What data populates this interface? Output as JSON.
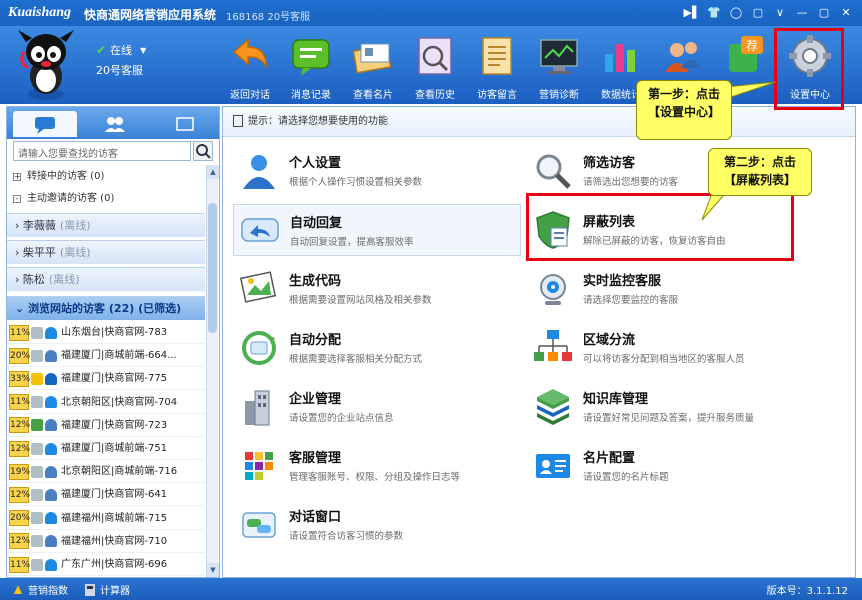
{
  "titlebar": {
    "logo": "Kuaishang",
    "title": "快商通网络营销应用系统",
    "account": "168168 20号客服",
    "buttons": [
      "▶▌",
      "👕",
      "◯",
      "▢",
      "∨",
      "—",
      "▢",
      "✕"
    ]
  },
  "agent": {
    "status": "在线",
    "name": "20号客服"
  },
  "toolbar": {
    "items": [
      {
        "label": "返回对话",
        "icon": "back-arrow-icon"
      },
      {
        "label": "消息记录",
        "icon": "message-log-icon"
      },
      {
        "label": "查看名片",
        "icon": "business-card-icon"
      },
      {
        "label": "查看历史",
        "icon": "history-icon"
      },
      {
        "label": "访客留言",
        "icon": "visitor-message-icon"
      },
      {
        "label": "营销诊断",
        "icon": "diagnosis-icon"
      },
      {
        "label": "数据统计",
        "icon": "statistics-icon"
      },
      {
        "label": "",
        "icon": "users-icon"
      },
      {
        "label": "",
        "icon": "recommend-icon"
      },
      {
        "label": "设置中心",
        "icon": "settings-gear-icon"
      }
    ],
    "recommend_badge": "荐"
  },
  "sidebar": {
    "search_placeholder": "请输入您要查找的访客",
    "tree": [
      {
        "label": "转接中的访客 (0)",
        "toggle": "+"
      },
      {
        "label": "主动邀请的访客 (0)",
        "toggle": "-"
      }
    ],
    "groups": [
      {
        "name": "李薇薇",
        "status": "(离线)"
      },
      {
        "name": "柴平平",
        "status": "(离线)"
      },
      {
        "name": "陈松",
        "status": "(离线)"
      }
    ],
    "open_group": {
      "label": "浏览网站的访客 (22) (已筛选)"
    },
    "visitors": [
      {
        "pct": "11%",
        "text": "山东烟台|快商官网-783"
      },
      {
        "pct": "20%",
        "text": "福建厦门|商城前端-664..."
      },
      {
        "pct": "33%",
        "text": "福建厦门|快商官网-775"
      },
      {
        "pct": "11%",
        "text": "北京朝阳区|快商官网-704"
      },
      {
        "pct": "12%",
        "text": "福建厦门|快商官网-723"
      },
      {
        "pct": "12%",
        "text": "福建厦门|商城前端-751"
      },
      {
        "pct": "19%",
        "text": "北京朝阳区|商城前端-716"
      },
      {
        "pct": "12%",
        "text": "福建厦门|快商官网-641"
      },
      {
        "pct": "20%",
        "text": "福建福州|商城前端-715"
      },
      {
        "pct": "12%",
        "text": "福建福州|快商官网-710"
      },
      {
        "pct": "11%",
        "text": "广东广州|快商官网-696"
      }
    ]
  },
  "main": {
    "tip": "提示：请选择您想要使用的功能",
    "features_left": [
      {
        "title": "个人设置",
        "desc": "根据个人操作习惯设置相关参数"
      },
      {
        "title": "自动回复",
        "desc": "自动回复设置，提高客服效率"
      },
      {
        "title": "生成代码",
        "desc": "根据需要设置网站风格及相关参数"
      },
      {
        "title": "自动分配",
        "desc": "根据需要选择客服相关分配方式"
      },
      {
        "title": "企业管理",
        "desc": "请设置您的企业站点信息"
      },
      {
        "title": "客服管理",
        "desc": "管理客服账号、权限、分组及操作日志等"
      },
      {
        "title": "对话窗口",
        "desc": "请设置符合访客习惯的参数"
      }
    ],
    "features_right": [
      {
        "title": "筛选访客",
        "desc": "请筛选出您想要的访客"
      },
      {
        "title": "屏蔽列表",
        "desc": "解除已屏蔽的访客，恢复访客自由"
      },
      {
        "title": "实时监控客服",
        "desc": "请选择您要监控的客服"
      },
      {
        "title": "区域分流",
        "desc": "可以将访客分配到相当地区的客服人员"
      },
      {
        "title": "知识库管理",
        "desc": "请设置好常见问题及答案，提升服务质量"
      },
      {
        "title": "名片配置",
        "desc": "请设置您的名片标题"
      }
    ]
  },
  "callouts": {
    "step1_line1": "第一步：点击",
    "step1_line2": "【设置中心】",
    "step2_line1": "第二步：点击",
    "step2_line2": "【屏蔽列表】"
  },
  "statusbar": {
    "marketing_index": "营销指数",
    "calculator": "计算器",
    "version": "版本号：3.1.1.12"
  },
  "colors": {
    "titlebar": "#1e6fd0",
    "toolbar": "#2a76d6",
    "highlight_red": "#e60012",
    "callout_yellow": "#ffff66",
    "percent_badge": "#f8d34c"
  }
}
